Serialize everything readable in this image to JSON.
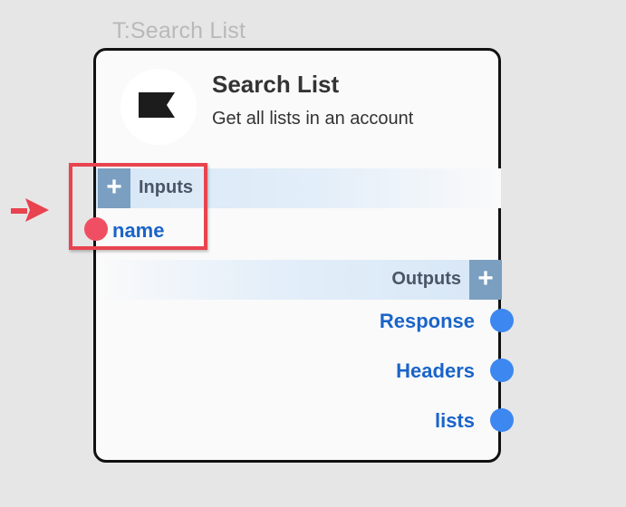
{
  "canvas": {
    "node_caption": "T:Search List"
  },
  "node": {
    "icon": "flag-icon",
    "title": "Search List",
    "subtitle": "Get all lists in an account",
    "inputs": {
      "label": "Inputs",
      "add_icon": "+",
      "ports": [
        {
          "label": "name"
        }
      ]
    },
    "outputs": {
      "label": "Outputs",
      "add_icon": "+",
      "ports": [
        {
          "label": "Response"
        },
        {
          "label": "Headers"
        },
        {
          "label": "lists"
        }
      ]
    }
  },
  "annotation": {
    "highlight_color": "#e8434f",
    "arrow_color": "#e8434f"
  },
  "colors": {
    "input_port": "#f04f63",
    "output_port": "#3c87f0",
    "port_label": "#1a64c8",
    "section_button": "#7a9fc0"
  }
}
